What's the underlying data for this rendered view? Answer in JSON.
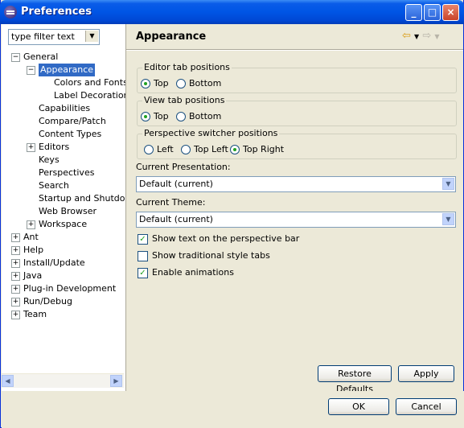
{
  "window": {
    "title": "Preferences"
  },
  "filter": {
    "text": "type filter text"
  },
  "tree": [
    {
      "label": "General",
      "level": 0,
      "expander": "−"
    },
    {
      "label": "Appearance",
      "level": 1,
      "expander": "−",
      "selected": true
    },
    {
      "label": "Colors and Fonts",
      "level": 2,
      "expander": ""
    },
    {
      "label": "Label Decorations",
      "level": 2,
      "expander": ""
    },
    {
      "label": "Capabilities",
      "level": 1,
      "expander": ""
    },
    {
      "label": "Compare/Patch",
      "level": 1,
      "expander": ""
    },
    {
      "label": "Content Types",
      "level": 1,
      "expander": ""
    },
    {
      "label": "Editors",
      "level": 1,
      "expander": "+"
    },
    {
      "label": "Keys",
      "level": 1,
      "expander": ""
    },
    {
      "label": "Perspectives",
      "level": 1,
      "expander": ""
    },
    {
      "label": "Search",
      "level": 1,
      "expander": ""
    },
    {
      "label": "Startup and Shutdown",
      "level": 1,
      "expander": ""
    },
    {
      "label": "Web Browser",
      "level": 1,
      "expander": ""
    },
    {
      "label": "Workspace",
      "level": 1,
      "expander": "+"
    },
    {
      "label": "Ant",
      "level": 0,
      "expander": "+"
    },
    {
      "label": "Help",
      "level": 0,
      "expander": "+"
    },
    {
      "label": "Install/Update",
      "level": 0,
      "expander": "+"
    },
    {
      "label": "Java",
      "level": 0,
      "expander": "+"
    },
    {
      "label": "Plug-in Development",
      "level": 0,
      "expander": "+"
    },
    {
      "label": "Run/Debug",
      "level": 0,
      "expander": "+"
    },
    {
      "label": "Team",
      "level": 0,
      "expander": "+"
    }
  ],
  "page": {
    "title": "Appearance",
    "editor_tab": {
      "label": "Editor tab positions",
      "options": [
        "Top",
        "Bottom"
      ],
      "selected": "Top"
    },
    "view_tab": {
      "label": "View tab positions",
      "options": [
        "Top",
        "Bottom"
      ],
      "selected": "Top"
    },
    "switcher": {
      "label": "Perspective switcher positions",
      "options": [
        "Left",
        "Top Left",
        "Top Right"
      ],
      "selected": "Top Right"
    },
    "presentation": {
      "label": "Current Presentation:",
      "value": "Default (current)"
    },
    "theme": {
      "label": "Current Theme:",
      "value": "Default (current)"
    },
    "checks": [
      {
        "label": "Show text on the perspective bar",
        "checked": true
      },
      {
        "label": "Show traditional style tabs",
        "checked": false
      },
      {
        "label": "Enable animations",
        "checked": true
      }
    ],
    "restore_label": "Restore Defaults",
    "apply_label": "Apply"
  },
  "buttons": {
    "ok": "OK",
    "cancel": "Cancel"
  },
  "colors": {
    "selection": "#316AC5",
    "titlebar": "#0055E5",
    "dialog_bg": "#ECE9D8"
  }
}
